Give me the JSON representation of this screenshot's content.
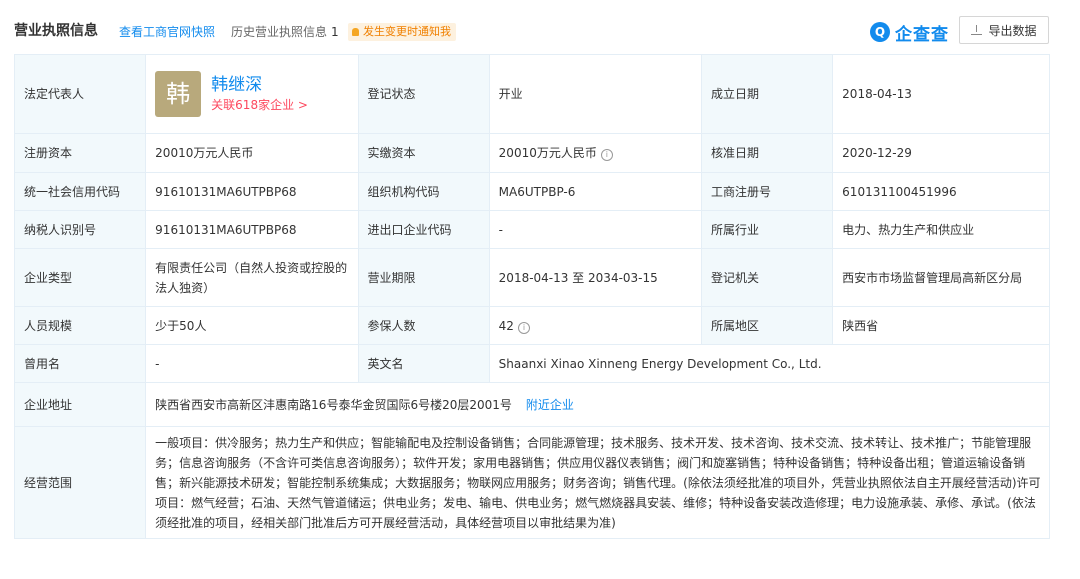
{
  "header": {
    "title": "营业执照信息",
    "link_gs": "查看工商官网快照",
    "history_label": "历史营业执照信息",
    "history_count": "1",
    "notice": "发生变更时通知我",
    "logo_text": "企查查",
    "export_label": "导出数据"
  },
  "rows": {
    "legal_rep_label": "法定代表人",
    "legal_rep_avatar": "韩",
    "legal_rep_name": "韩继深",
    "legal_rep_link": "关联618家企业 >",
    "reg_status_label": "登记状态",
    "reg_status": "开业",
    "est_date_label": "成立日期",
    "est_date": "2018-04-13",
    "reg_capital_label": "注册资本",
    "reg_capital": "20010万元人民币",
    "paid_capital_label": "实缴资本",
    "paid_capital": "20010万元人民币",
    "approve_date_label": "核准日期",
    "approve_date": "2020-12-29",
    "credit_code_label": "统一社会信用代码",
    "credit_code": "91610131MA6UTPBP68",
    "org_code_label": "组织机构代码",
    "org_code": "MA6UTPBP-6",
    "biz_reg_label": "工商注册号",
    "biz_reg": "610131100451996",
    "tax_id_label": "纳税人识别号",
    "tax_id": "91610131MA6UTPBP68",
    "import_export_label": "进出口企业代码",
    "import_export": "-",
    "industry_label": "所属行业",
    "industry": "电力、热力生产和供应业",
    "ent_type_label": "企业类型",
    "ent_type": "有限责任公司（自然人投资或控股的法人独资）",
    "term_label": "营业期限",
    "term": "2018-04-13 至 2034-03-15",
    "authority_label": "登记机关",
    "authority": "西安市市场监督管理局高新区分局",
    "staff_label": "人员规模",
    "staff": "少于50人",
    "insured_label": "参保人数",
    "insured": "42",
    "region_label": "所属地区",
    "region": "陕西省",
    "former_name_label": "曾用名",
    "former_name": "-",
    "en_name_label": "英文名",
    "en_name": "Shaanxi Xinao Xinneng Energy Development Co., Ltd.",
    "address_label": "企业地址",
    "address": "陕西省西安市高新区沣惠南路16号泰华金贸国际6号楼20层2001号",
    "nearby_label": "附近企业",
    "scope_label": "经营范围",
    "scope": "一般项目：供冷服务；热力生产和供应；智能输配电及控制设备销售；合同能源管理；技术服务、技术开发、技术咨询、技术交流、技术转让、技术推广；节能管理服务；信息咨询服务（不含许可类信息咨询服务）；软件开发；家用电器销售；供应用仪器仪表销售；阀门和旋塞销售；特种设备销售；特种设备出租；管道运输设备销售；新兴能源技术研发；智能控制系统集成；大数据服务；物联网应用服务；财务咨询；销售代理。(除依法须经批准的项目外，凭营业执照依法自主开展经营活动)许可项目：燃气经营；石油、天然气管道储运；供电业务；发电、输电、供电业务；燃气燃烧器具安装、维修；特种设备安装改造修理；电力设施承装、承修、承试。(依法须经批准的项目，经相关部门批准后方可开展经营活动，具体经营项目以审批结果为准)"
  },
  "colors": {
    "link": "#128bed",
    "label_bg": "#f2f9fc",
    "border": "#e4eef6",
    "avatar_bg": "#b8a97c",
    "red_link": "#fd485e",
    "notice_bg": "#fdf1df",
    "notice_text": "#f08000"
  },
  "icons": [
    "bell-icon",
    "logo-icon",
    "download-icon",
    "info-icon"
  ]
}
